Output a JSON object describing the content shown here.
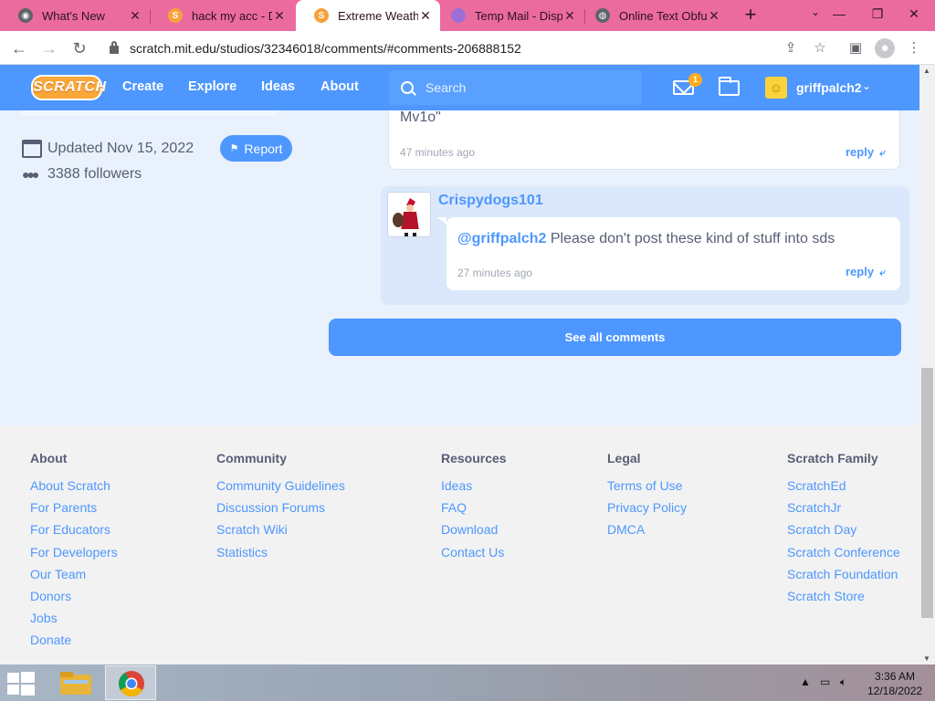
{
  "browser": {
    "tabs": [
      {
        "title": "What's New",
        "icon": "chrome-icon",
        "color": "#5f6368"
      },
      {
        "title": "hack my acc - Dra",
        "icon": "scratch-icon",
        "color": "#f7a23a"
      },
      {
        "title": "Extreme Weather",
        "icon": "scratch-icon",
        "color": "#f7a23a",
        "active": true
      },
      {
        "title": "Temp Mail - Dispo",
        "icon": "tempmail-icon",
        "color": "#9c6fd6"
      },
      {
        "title": "Online Text Obfu",
        "icon": "globe-icon",
        "color": "#5f6368"
      }
    ],
    "url": "scratch.mit.edu/studios/32346018/comments/#comments-206888152"
  },
  "nav": {
    "logo": "SCRATCH",
    "links": [
      "Create",
      "Explore",
      "Ideas",
      "About"
    ],
    "search_placeholder": "Search",
    "messages_count": "1",
    "username": "griffpalch2"
  },
  "studio": {
    "updated": "Updated Nov 15, 2022",
    "followers": "3388 followers",
    "report_label": "Report"
  },
  "comments": {
    "top": {
      "text": "Mv1o\"",
      "time": "47 minutes ago",
      "reply": "reply"
    },
    "reply": {
      "user": "Crispydogs101",
      "mention": "@griffpalch2",
      "text": "Please don't post these kind of stuff into sds",
      "time": "27 minutes ago",
      "reply": "reply"
    },
    "see_all": "See all comments"
  },
  "footer": {
    "columns": [
      {
        "heading": "About",
        "links": [
          "About Scratch",
          "For Parents",
          "For Educators",
          "For Developers",
          "Our Team",
          "Donors",
          "Jobs",
          "Donate"
        ]
      },
      {
        "heading": "Community",
        "links": [
          "Community Guidelines",
          "Discussion Forums",
          "Scratch Wiki",
          "Statistics"
        ]
      },
      {
        "heading": "Resources",
        "links": [
          "Ideas",
          "FAQ",
          "Download",
          "Contact Us"
        ]
      },
      {
        "heading": "Legal",
        "links": [
          "Terms of Use",
          "Privacy Policy",
          "DMCA"
        ]
      },
      {
        "heading": "Scratch Family",
        "links": [
          "ScratchEd",
          "ScratchJr",
          "Scratch Day",
          "Scratch Conference",
          "Scratch Foundation",
          "Scratch Store"
        ]
      }
    ]
  },
  "taskbar": {
    "time": "3:36 AM",
    "date": "12/18/2022"
  },
  "colors": {
    "scratch_blue": "#4d97ff",
    "tabstrip": "#ec6b9e",
    "footer_bg": "#f2f2f2"
  }
}
